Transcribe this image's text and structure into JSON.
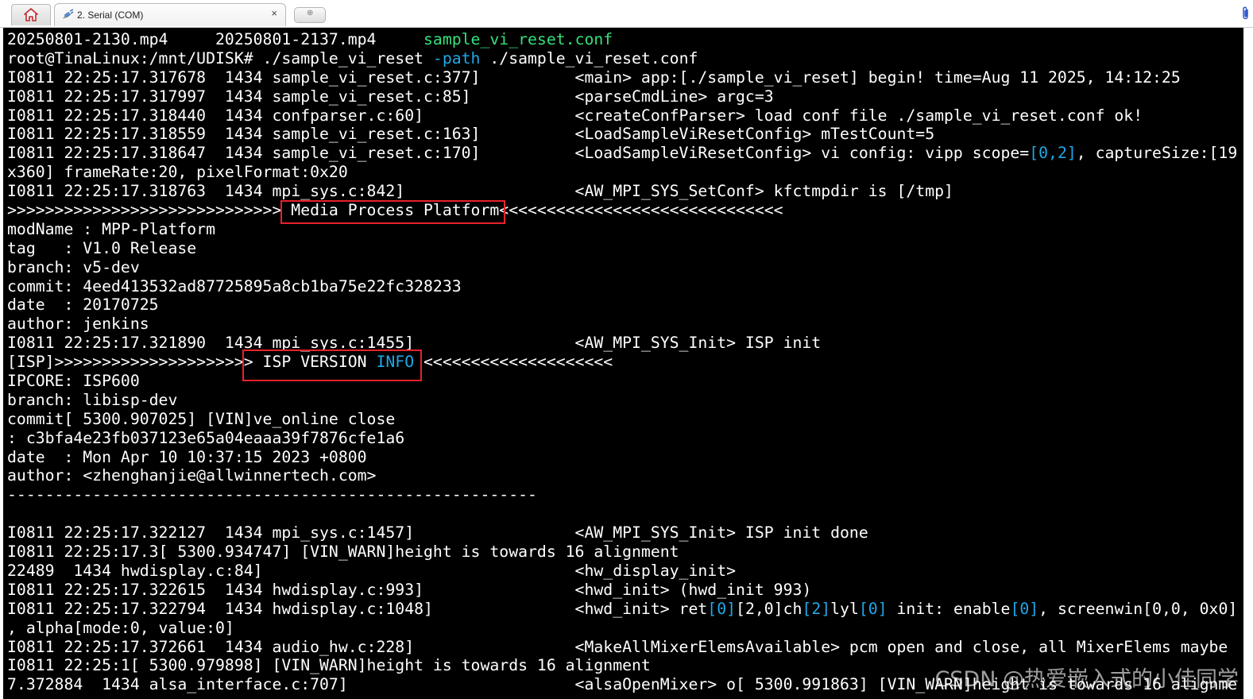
{
  "tabbar": {
    "home_icon": "home-icon",
    "tab_label": "2. Serial (COM)",
    "tab_icon": "plug-icon",
    "close_glyph": "×",
    "new_tab_glyph": "⊕"
  },
  "colors": {
    "terminal_bg": "#000000",
    "text": "#ffffff",
    "green": "#35e07a",
    "cyan": "#1fa8e8",
    "highlight_box": "#e8212b"
  },
  "terminal": {
    "lines": [
      [
        {
          "t": "20250801-2130.mp4     20250801-2137.mp4     "
        },
        {
          "t": "sample_vi_reset.conf",
          "c": "green"
        }
      ],
      [
        {
          "t": "root@TinaLinux:/mnt/UDISK# ./sample_vi_reset "
        },
        {
          "t": "-path",
          "c": "cyan"
        },
        {
          "t": " ./sample_vi_reset.conf"
        }
      ],
      [
        {
          "t": "I0811 22:25:17.317678  1434 sample_vi_reset.c:377]          <main> app:[./sample_vi_reset] begin! time=Aug 11 2025, 14:12:25"
        }
      ],
      [
        {
          "t": "I0811 22:25:17.317997  1434 sample_vi_reset.c:85]           <parseCmdLine> argc=3"
        }
      ],
      [
        {
          "t": "I0811 22:25:17.318440  1434 confparser.c:60]                <createConfParser> load conf file ./sample_vi_reset.conf ok!"
        }
      ],
      [
        {
          "t": "I0811 22:25:17.318559  1434 sample_vi_reset.c:163]          <LoadSampleViResetConfig> mTestCount=5"
        }
      ],
      [
        {
          "t": "I0811 22:25:17.318647  1434 sample_vi_reset.c:170]          <LoadSampleViResetConfig> vi config: vipp scope="
        },
        {
          "t": "[0,2]",
          "c": "cyan"
        },
        {
          "t": ", captureSize:[19"
        }
      ],
      [
        {
          "t": "x360] frameRate:20, pixelFormat:0x20"
        }
      ],
      [
        {
          "t": "I0811 22:25:17.318763  1434 mpi_sys.c:842]                  <AW_MPI_SYS_SetConf> kfctmpdir is [/tmp]"
        }
      ],
      [
        {
          "t": ">>>>>>>>>>>>>>>>>>>>>>>>>>>>> Media Process Platform<<<<<<<<<<<<<<<<<<<<<<<<<<<<<<"
        }
      ],
      [
        {
          "t": "modName : MPP-Platform"
        }
      ],
      [
        {
          "t": "tag   : V1.0 Release"
        }
      ],
      [
        {
          "t": "branch: v5-dev"
        }
      ],
      [
        {
          "t": "commit: 4eed413532ad87725895a8cb1ba75e22fc328233"
        }
      ],
      [
        {
          "t": "date  : 20170725"
        }
      ],
      [
        {
          "t": "author: jenkins"
        }
      ],
      [
        {
          "t": "I0811 22:25:17.321890  1434 mpi_sys.c:1455]                 <AW_MPI_SYS_Init> ISP init"
        }
      ],
      [
        {
          "t": "[ISP]>>>>>>>>>>>>>>>>>>>>> ISP VERSION "
        },
        {
          "t": "INFO",
          "c": "cyan"
        },
        {
          "t": " <<<<<<<<<<<<<<<<<<<<"
        }
      ],
      [
        {
          "t": "IPCORE: ISP600"
        }
      ],
      [
        {
          "t": "branch: libisp-dev"
        }
      ],
      [
        {
          "t": "commit[ 5300.907025] [VIN]ve_online close"
        }
      ],
      [
        {
          "t": ": c3bfa4e23fb037123e65a04eaaa39f7876cfe1a6"
        }
      ],
      [
        {
          "t": "date  : Mon Apr 10 10:37:15 2023 +0800"
        }
      ],
      [
        {
          "t": "author: <zhenghanjie@allwinnertech.com>"
        }
      ],
      [
        {
          "t": "--------------------------------------------------------"
        }
      ],
      [
        {
          "t": ""
        }
      ],
      [
        {
          "t": "I0811 22:25:17.322127  1434 mpi_sys.c:1457]                 <AW_MPI_SYS_Init> ISP init done"
        }
      ],
      [
        {
          "t": "I0811 22:25:17.3[ 5300.934747] [VIN_WARN]height is towards 16 alignment"
        }
      ],
      [
        {
          "t": "22489  1434 hwdisplay.c:84]                                 <hw_display_init>"
        }
      ],
      [
        {
          "t": "I0811 22:25:17.322615  1434 hwdisplay.c:993]                <hwd_init> (hwd_init 993)"
        }
      ],
      [
        {
          "t": "I0811 22:25:17.322794  1434 hwdisplay.c:1048]               <hwd_init> ret"
        },
        {
          "t": "[0]",
          "c": "cyan"
        },
        {
          "t": "[2,0]ch"
        },
        {
          "t": "[2]",
          "c": "cyan"
        },
        {
          "t": "lyl"
        },
        {
          "t": "[0]",
          "c": "cyan"
        },
        {
          "t": " init: enable"
        },
        {
          "t": "[0]",
          "c": "cyan"
        },
        {
          "t": ", screenwin[0,0, 0x0]"
        }
      ],
      [
        {
          "t": ", alpha[mode:0, value:0]"
        }
      ],
      [
        {
          "t": "I0811 22:25:17.372661  1434 audio_hw.c:228]                 <MakeAllMixerElemsAvailable> pcm open and close, all MixerElems maybe"
        }
      ],
      [
        {
          "t": "I0811 22:25:1[ 5300.979898] [VIN_WARN]height is towards 16 alignment"
        }
      ],
      [
        {
          "t": "7.372884  1434 alsa_interface.c:707]                        <alsaOpenMixer> o[ 5300.991863] [VIN_WARN]height is towards 16 alignme"
        }
      ]
    ]
  },
  "watermark": "CSDN @热爱嵌入式的小佳同学"
}
